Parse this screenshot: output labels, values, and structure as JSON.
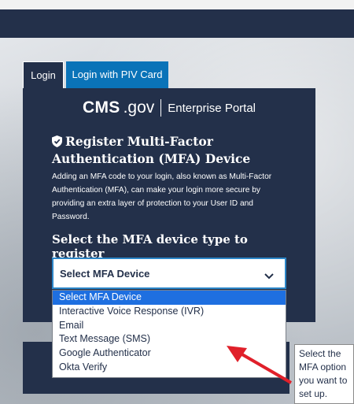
{
  "tabs": [
    {
      "label": "Login",
      "active": true
    },
    {
      "label": "Login with PIV Card",
      "active": false
    }
  ],
  "logo": {
    "brand": "CMS",
    "domain": ".gov",
    "portal": "Enterprise Portal"
  },
  "card": {
    "icon": "shield-check-icon",
    "title": "Register Multi-Factor Authentication (MFA) Device",
    "description": "Adding an MFA code to your login, also known as Multi-Factor Authentication (MFA), can make your login more secure by providing an extra layer of protection to your User ID and Password.",
    "select_label": "Select the MFA device type to register"
  },
  "select": {
    "value": "Select MFA Device",
    "options": [
      "Select MFA Device",
      "Interactive Voice Response (IVR)",
      "Email",
      "Text Message (SMS)",
      "Google Authenticator",
      "Okta Verify"
    ],
    "selected_index": 0
  },
  "callout": {
    "text": "Select the MFA option you want to set up."
  },
  "colors": {
    "navy": "#23304a",
    "accent_blue": "#0a73b8",
    "highlight": "#1e6fe0",
    "arrow": "#e0202a"
  }
}
